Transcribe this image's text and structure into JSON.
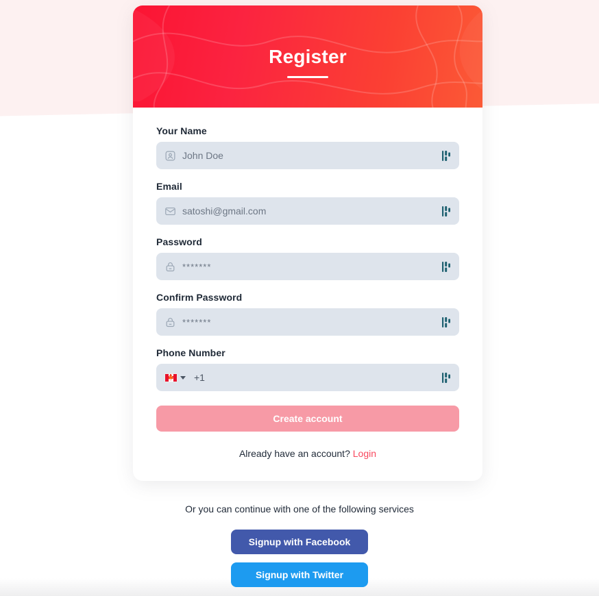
{
  "theme": {
    "hero_gradient_from": "#fb1433",
    "hero_gradient_to": "#fb5a36",
    "input_background": "#dee4ec",
    "submit_background": "#f79aa6",
    "link_color": "#f8485e",
    "facebook_color": "#4259ab",
    "twitter_color": "#1d9bf0",
    "page_band_color": "#fdf1f1"
  },
  "hero": {
    "title": "Register"
  },
  "form": {
    "fields": [
      {
        "label": "Your Name",
        "placeholder": "John Doe",
        "lead_icon": "user-icon",
        "tail_icon": "strength-bars-icon"
      },
      {
        "label": "Email",
        "placeholder": "satoshi@gmail.com",
        "lead_icon": "envelope-icon",
        "tail_icon": "strength-bars-icon"
      },
      {
        "label": "Password",
        "placeholder": "*******",
        "lead_icon": "lock-icon",
        "tail_icon": "strength-bars-icon"
      },
      {
        "label": "Confirm Password",
        "placeholder": "*******",
        "lead_icon": "lock-icon",
        "tail_icon": "strength-bars-icon"
      }
    ],
    "phone": {
      "label": "Phone Number",
      "country_flag": "canada-flag-icon",
      "country_caret": "chevron-down-icon",
      "dial_code": "+1",
      "tail_icon": "strength-bars-icon"
    },
    "submit_label": "Create account"
  },
  "login_prompt": {
    "text": "Already have an account?",
    "link_label": "Login"
  },
  "social": {
    "caption": "Or you can continue with one of the following services",
    "buttons": [
      {
        "label": "Signup with Facebook"
      },
      {
        "label": "Signup with Twitter"
      }
    ]
  }
}
